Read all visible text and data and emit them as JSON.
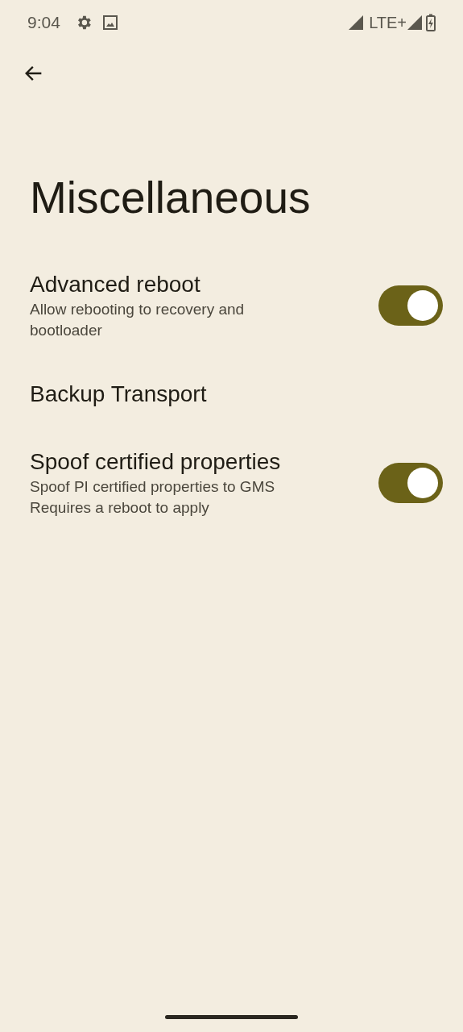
{
  "status_bar": {
    "time": "9:04",
    "network": "LTE+"
  },
  "title": "Miscellaneous",
  "settings": [
    {
      "kind": "toggle",
      "title": "Advanced reboot",
      "summary": [
        "Allow rebooting to recovery and bootloader"
      ],
      "on": true
    },
    {
      "kind": "plain",
      "title": "Backup Transport"
    },
    {
      "kind": "toggle",
      "title": "Spoof certified properties",
      "summary": [
        "Spoof PI certified properties to GMS",
        "Requires a reboot to apply"
      ],
      "on": true
    }
  ]
}
